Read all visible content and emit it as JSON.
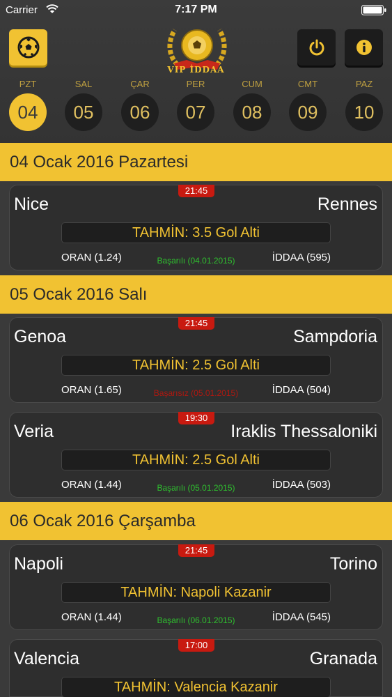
{
  "status_bar": {
    "carrier": "Carrier",
    "time": "7:17 PM"
  },
  "app": {
    "title": "VIP İDDAA"
  },
  "days": [
    {
      "label": "PZT",
      "number": "04"
    },
    {
      "label": "SAL",
      "number": "05"
    },
    {
      "label": "ÇAR",
      "number": "06"
    },
    {
      "label": "PER",
      "number": "07"
    },
    {
      "label": "CUM",
      "number": "08"
    },
    {
      "label": "CMT",
      "number": "09"
    },
    {
      "label": "PAZ",
      "number": "10"
    }
  ],
  "sections": [
    {
      "date": "04 Ocak 2016 Pazartesi",
      "matches": [
        {
          "time": "21:45",
          "home": "Nice",
          "away": "Rennes",
          "tahmin": "TAHMİN: 3.5 Gol Alti",
          "oran": "ORAN (1.24)",
          "result": "Başarılı (04.01.2015)",
          "iddaa": "İDDAA (595)"
        }
      ]
    },
    {
      "date": "05 Ocak 2016 Salı",
      "matches": [
        {
          "time": "21:45",
          "home": "Genoa",
          "away": "Sampdoria",
          "tahmin": "TAHMİN: 2.5 Gol Alti",
          "oran": "ORAN (1.65)",
          "result": "Başarısız (05.01.2015)",
          "iddaa": "İDDAA (504)"
        },
        {
          "time": "19:30",
          "home": "Veria",
          "away": "Iraklis Thessaloniki",
          "tahmin": "TAHMİN: 2.5 Gol Alti",
          "oran": "ORAN (1.44)",
          "result": "Başarılı (05.01.2015)",
          "iddaa": "İDDAA (503)"
        }
      ]
    },
    {
      "date": "06 Ocak 2016 Çarşamba",
      "matches": [
        {
          "time": "21:45",
          "home": "Napoli",
          "away": "Torino",
          "tahmin": "TAHMİN: Napoli Kazanir",
          "oran": "ORAN (1.44)",
          "result": "Başarılı (06.01.2015)",
          "iddaa": "İDDAA (545)"
        },
        {
          "time": "17:00",
          "home": "Valencia",
          "away": "Granada",
          "tahmin": "TAHMİN: Valencia Kazanir"
        }
      ]
    }
  ],
  "colors": {
    "accent": "#f1c232",
    "success": "#2fbf2f",
    "failure": "#b01810",
    "badge": "#c81a10"
  },
  "icons": {
    "ball_button": "soccer-ball-icon",
    "power_button": "power-icon",
    "info_button": "info-icon"
  }
}
